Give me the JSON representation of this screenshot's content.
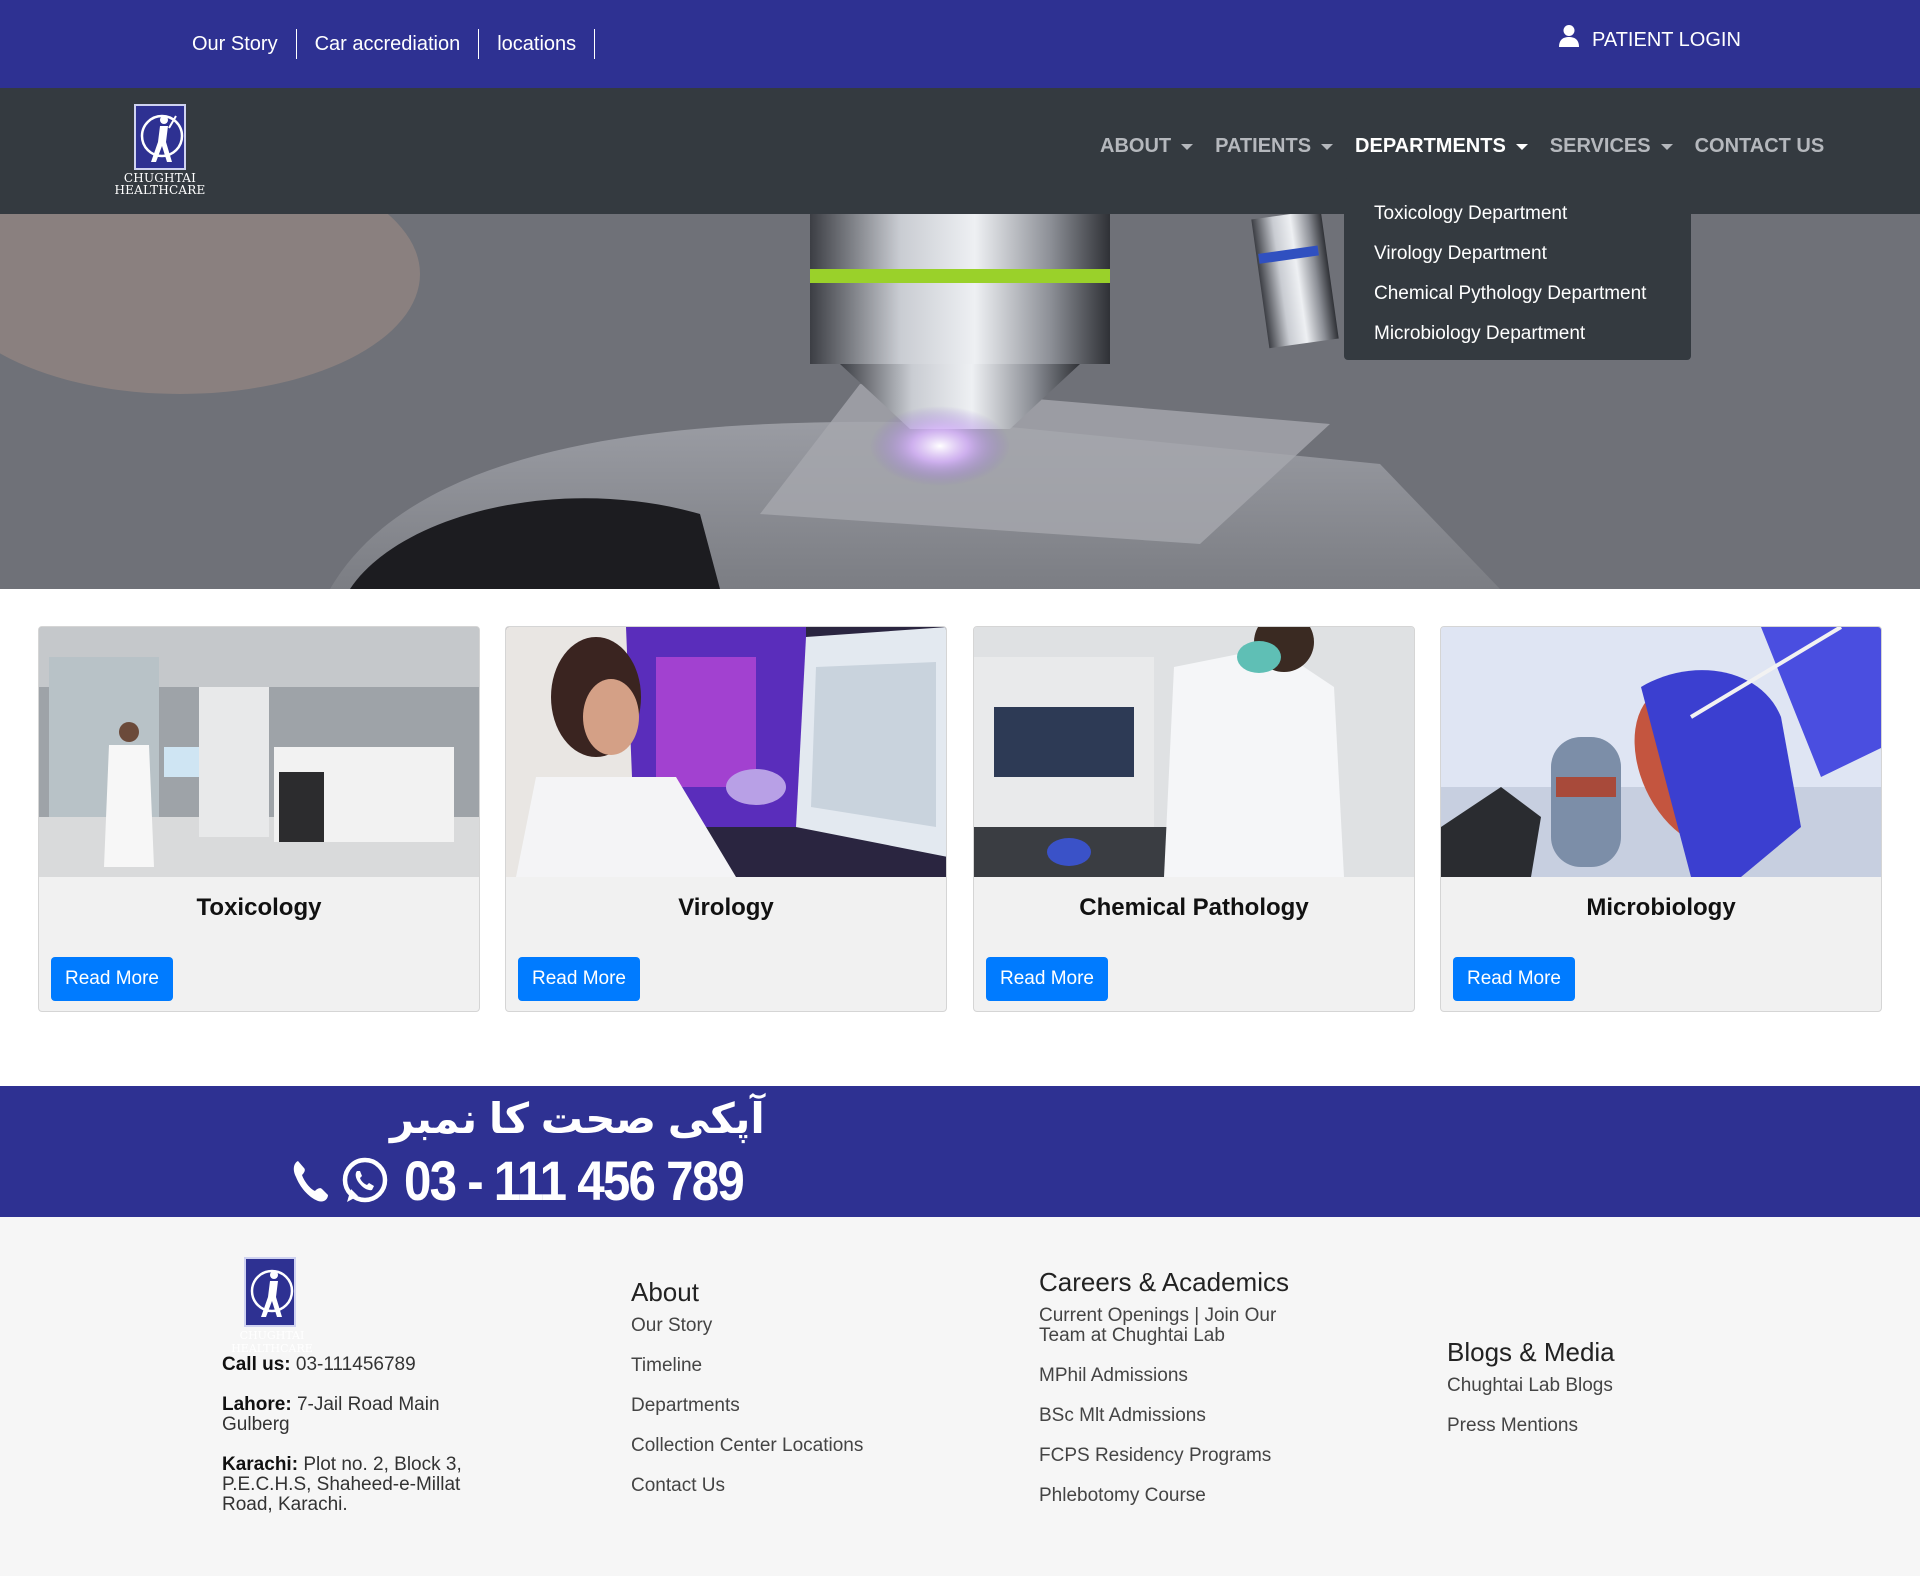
{
  "topbar": {
    "links": [
      "Our Story",
      "Car accrediation",
      "locations"
    ],
    "login_label": "PATIENT LOGIN",
    "login_icon": "user-icon"
  },
  "brand": {
    "logo_line1": "CHUGHTAI",
    "logo_line2": "HEALTHCARE"
  },
  "nav": {
    "items": [
      {
        "label": "ABOUT",
        "dropdown": true
      },
      {
        "label": "PATIENTS",
        "dropdown": true
      },
      {
        "label": "DEPARTMENTS",
        "dropdown": true,
        "active": true
      },
      {
        "label": "SERVICES",
        "dropdown": true
      },
      {
        "label": "CONTACT US",
        "dropdown": false
      }
    ],
    "departments_menu": [
      "Toxicology Department",
      "Virology Department",
      "Chemical Pythology Department",
      "Microbiology Department"
    ]
  },
  "cards": [
    {
      "title": "Toxicology",
      "button": "Read More"
    },
    {
      "title": "Virology",
      "button": "Read More"
    },
    {
      "title": "Chemical Pathology",
      "button": "Read More"
    },
    {
      "title": "Microbiology",
      "button": "Read More"
    }
  ],
  "hotline": {
    "urdu": "آپکی صحت کا نمبر",
    "number": "03 - 111 456 789"
  },
  "footer": {
    "contact": {
      "call_label": "Call us:",
      "call_value": "03-111456789",
      "lahore_label": "Lahore:",
      "lahore_value": "7-Jail Road Main Gulberg",
      "karachi_label": "Karachi:",
      "karachi_value": "Plot no. 2, Block 3, P.E.C.H.S, Shaheed-e-Millat Road, Karachi."
    },
    "about": {
      "heading": "About",
      "links": [
        "Our Story",
        "Timeline",
        "Departments",
        "Collection Center Locations",
        "Contact Us"
      ]
    },
    "careers": {
      "heading": "Careers & Academics",
      "links": [
        "Current Openings | Join Our Team at Chughtai Lab",
        "MPhil Admissions",
        "BSc Mlt Admissions",
        "FCPS Residency Programs",
        "Phlebotomy Course"
      ]
    },
    "blogs": {
      "heading": "Blogs & Media",
      "links": [
        "Chughtai Lab Blogs",
        "Press Mentions"
      ]
    }
  },
  "colors": {
    "brand_blue": "#2e3192",
    "navbar": "#343a40",
    "button_blue": "#007bff"
  }
}
